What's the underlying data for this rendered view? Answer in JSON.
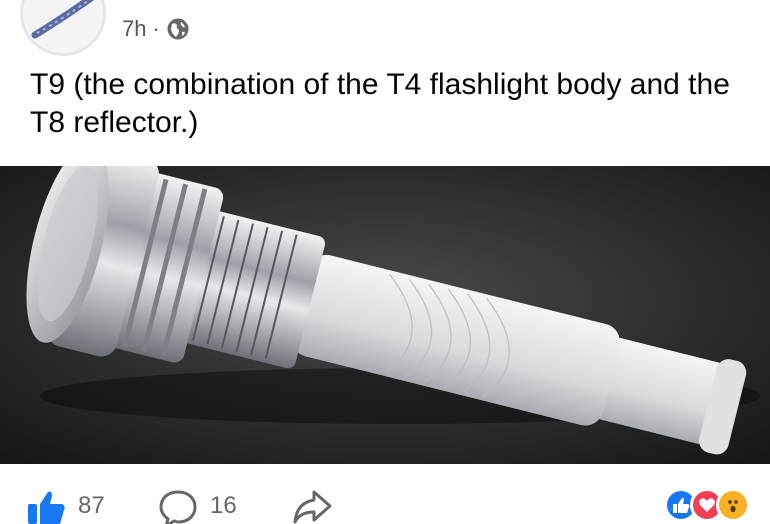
{
  "post": {
    "time": "7h",
    "separator": "·",
    "privacy_icon": "globe-icon",
    "text": "T9 (the combination of the T4 flashlight body and the T8 reflector.)"
  },
  "photo": {
    "subject": "flashlight-photo"
  },
  "actions": {
    "like_count": "87",
    "comment_count": "16",
    "like_icon": "thumbs-up-icon",
    "comment_icon": "comment-icon",
    "share_icon": "share-icon"
  },
  "reactions": [
    {
      "name": "like-reaction-icon",
      "color": "#1877f2"
    },
    {
      "name": "love-reaction-icon",
      "color": "#f33e58"
    },
    {
      "name": "wow-reaction-icon",
      "color": "#f7b125"
    }
  ],
  "colors": {
    "text": "#050505",
    "meta": "#65676b",
    "accent": "#1877f2"
  }
}
